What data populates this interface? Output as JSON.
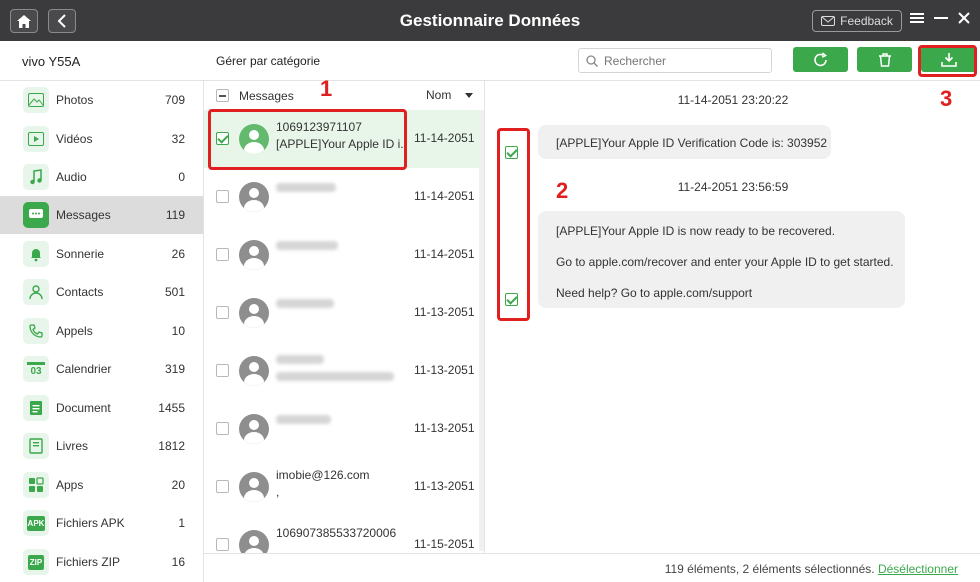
{
  "titlebar": {
    "title": "Gestionnaire Données",
    "feedback_label": "Feedback",
    "home_icon": "home-icon",
    "back_icon": "chevron-left-icon"
  },
  "header": {
    "device_name": "vivo Y55A",
    "category_label": "Gérer par catégorie",
    "search_placeholder": "Rechercher"
  },
  "sidebar": {
    "items": [
      {
        "label": "Photos",
        "count": "709",
        "icon": "photo-icon"
      },
      {
        "label": "Vidéos",
        "count": "32",
        "icon": "video-icon"
      },
      {
        "label": "Audio",
        "count": "0",
        "icon": "music-icon"
      },
      {
        "label": "Messages",
        "count": "119",
        "icon": "message-icon"
      },
      {
        "label": "Sonnerie",
        "count": "26",
        "icon": "bell-icon"
      },
      {
        "label": "Contacts",
        "count": "501",
        "icon": "contact-icon"
      },
      {
        "label": "Appels",
        "count": "10",
        "icon": "phone-icon"
      },
      {
        "label": "Calendrier",
        "count": "319",
        "icon": "calendar-icon"
      },
      {
        "label": "Document",
        "count": "1455",
        "icon": "document-icon"
      },
      {
        "label": "Livres",
        "count": "1812",
        "icon": "book-icon"
      },
      {
        "label": "Apps",
        "count": "20",
        "icon": "apps-icon"
      },
      {
        "label": "Fichiers APK",
        "count": "1",
        "icon": "apk-icon"
      },
      {
        "label": "Fichiers ZIP",
        "count": "16",
        "icon": "zip-icon"
      }
    ],
    "calendar_day": "03",
    "apk_text": "APK",
    "zip_text": "ZIP"
  },
  "list": {
    "header_label": "Messages",
    "sort_label": "Nom",
    "rows": [
      {
        "title": "1069123971107",
        "sub": "[APPLE]Your Apple ID i...",
        "date": "11-14-2051",
        "checked": true
      },
      {
        "title": "",
        "sub": "",
        "date": "11-14-2051",
        "checked": false
      },
      {
        "title": "",
        "sub": "",
        "date": "11-14-2051",
        "checked": false
      },
      {
        "title": "",
        "sub": "",
        "date": "11-13-2051",
        "checked": false
      },
      {
        "title": "",
        "sub": "",
        "date": "11-13-2051",
        "checked": false
      },
      {
        "title": "",
        "sub": "",
        "date": "11-13-2051",
        "checked": false
      },
      {
        "title": "imobie@126.com",
        "sub": ",",
        "date": "11-13-2051",
        "checked": false
      },
      {
        "title": "106907385533720006",
        "sub": "",
        "date": "11-15-2051",
        "checked": false
      }
    ]
  },
  "conversation": {
    "messages": [
      {
        "timestamp": "11-14-2051 23:20:22",
        "lines": [
          "[APPLE]Your Apple ID Verification Code is: 303952"
        ]
      },
      {
        "timestamp": "11-24-2051 23:56:59",
        "lines": [
          "[APPLE]Your Apple ID is now ready to be recovered.",
          "Go to apple.com/recover and enter your Apple ID to get started.",
          "Need help? Go to apple.com/support"
        ]
      }
    ]
  },
  "status": {
    "text": "119 éléments, 2 éléments sélectionnés.",
    "deselect_label": "Désélectionner"
  },
  "annotations": {
    "one": "1",
    "two": "2",
    "three": "3",
    "color": "#e02020"
  },
  "colors": {
    "accent": "#3aa84b",
    "titlebar": "#3b3b3d"
  }
}
